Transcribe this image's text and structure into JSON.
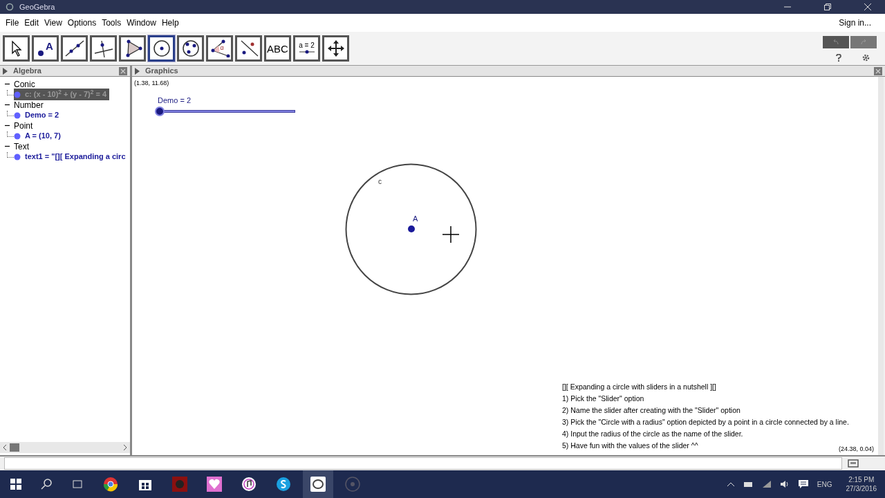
{
  "window": {
    "title": "GeoGebra"
  },
  "menu": [
    "File",
    "Edit",
    "View",
    "Options",
    "Tools",
    "Window",
    "Help"
  ],
  "sign_in": "Sign in...",
  "tools": [
    {
      "kind": "arrow",
      "selected": false
    },
    {
      "kind": "point",
      "label": "A",
      "selected": false
    },
    {
      "kind": "line",
      "selected": false
    },
    {
      "kind": "perpendicular",
      "selected": false
    },
    {
      "kind": "polygon",
      "selected": false
    },
    {
      "kind": "circle",
      "selected": true
    },
    {
      "kind": "circle3",
      "selected": false
    },
    {
      "kind": "angle",
      "label": "α",
      "selected": false
    },
    {
      "kind": "reflect",
      "selected": false
    },
    {
      "kind": "text",
      "label": "ABC",
      "selected": false
    },
    {
      "kind": "slider",
      "label": "a = 2",
      "selected": false
    },
    {
      "kind": "move",
      "selected": false
    }
  ],
  "algebra": {
    "title": "Algebra",
    "items": [
      {
        "label": "Conic",
        "expanded": true,
        "children": [
          {
            "label": "c: (x - 10)$^{2}$ + (y - 7)$^{2}$ = 4",
            "selected": true
          }
        ]
      },
      {
        "label": "Number",
        "expanded": true,
        "children": [
          {
            "label": "Demo = 2",
            "selected": false
          }
        ]
      },
      {
        "label": "Point",
        "expanded": true,
        "children": [
          {
            "label": "A = (10, 7)",
            "selected": false
          }
        ]
      },
      {
        "label": "Text",
        "expanded": true,
        "children": [
          {
            "label": "text1 = \"[][ Expanding a circ",
            "selected": false
          }
        ]
      }
    ]
  },
  "graphics": {
    "title": "Graphics",
    "mouse_coords_top": "(1.38, 11.68)",
    "slider": {
      "label": "Demo = 2",
      "level": 0
    },
    "circle_label": "c",
    "point_label": "A",
    "text_lines": [
      "[][ Expanding a circle with sliders in a nutshell ][]",
      "1) Pick the \"Slider\" option",
      "2) Name the slider after creating with the \"Slider\" option",
      "3) Pick the \"Circle with a radius\" option depicted by a point in a circle connected by a line.",
      "4) Input the radius of the circle as the name of the slider.",
      "5) Have fun with the values of the slider ^^"
    ],
    "mouse_coords_bottom": "(24.38, 0.04)"
  },
  "taskbar": {
    "language": "ENG",
    "time": "2:15 PM",
    "date": "27/3/2016"
  }
}
